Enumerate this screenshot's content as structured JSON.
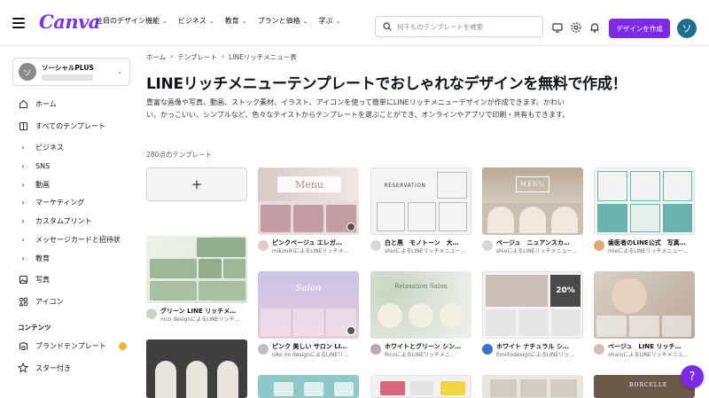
{
  "brand": {
    "logo": "Canva",
    "accent": "#7d2ae8"
  },
  "nav": {
    "items": [
      "注目のデザイン機能",
      "ビジネス",
      "教育",
      "プランと価格",
      "学ぶ"
    ]
  },
  "search": {
    "placeholder": "何千ものテンプレートを検索"
  },
  "header": {
    "cta": "デザインを作成",
    "avatar_initial": "ソ"
  },
  "sidebar": {
    "team": {
      "initial": "ソ",
      "name": "ソーシャルPLUS"
    },
    "items": [
      {
        "label": "ホーム",
        "icon": "home-icon"
      },
      {
        "label": "すべてのテンプレート",
        "icon": "templates-icon"
      },
      {
        "label": "ビジネス",
        "icon": "chevron-right-icon"
      },
      {
        "label": "SNS",
        "icon": "chevron-right-icon"
      },
      {
        "label": "動画",
        "icon": "chevron-right-icon"
      },
      {
        "label": "マーケティング",
        "icon": "chevron-right-icon"
      },
      {
        "label": "カスタムプリント",
        "icon": "chevron-right-icon"
      },
      {
        "label": "メッセージカードと招待状",
        "icon": "chevron-right-icon"
      },
      {
        "label": "教育",
        "icon": "chevron-right-icon"
      },
      {
        "label": "写真",
        "icon": "photo-icon"
      },
      {
        "label": "アイコン",
        "icon": "shapes-icon"
      }
    ],
    "section_heading": "コンテンツ",
    "content_items": [
      {
        "label": "ブランドテンプレート",
        "icon": "brand-icon"
      },
      {
        "label": "スター付き",
        "icon": "star-icon"
      }
    ]
  },
  "breadcrumb": [
    "ホーム",
    "テンプレート",
    "LINEリッチメニュー表"
  ],
  "page": {
    "title": "LINEリッチメニューテンプレートでおしゃれなデザインを無料で作成！",
    "description": "豊富な画像や写真、動画、ストック素材、イラスト、アイコンを使って簡単にLINEリッチメニューデザインが作成できます。かわいい、かっこいい、シンプルなど、色々なテイストからテンプレートを選ぶことができ、オンラインやアプリで印刷・共有もできます。",
    "count": "280点のテンプレート",
    "new_button": "+"
  },
  "templates": [
    {
      "title": "ピンクベージュ エレガ…",
      "by": "mikimikiによるLINEリッチメ…",
      "thumb_text": "Menu"
    },
    {
      "title": "白と黒　モノトーン　大…",
      "by": "shioによるLINEリッチメニュー…",
      "thumb_text": "RESERVATION"
    },
    {
      "title": "ベージュ　ニュアンスカ…",
      "by": "shioによるLINEリッチメニュー…",
      "thumb_text": "MENU"
    },
    {
      "title": "歯医者のLINE公式　写真…",
      "by": "mieによるLINEリッチメニュー…",
      "thumb_text": ""
    },
    {
      "title": "グリーン LINE リッチメ…",
      "by": "nico designによるLINEリッチ…",
      "thumb_text": ""
    },
    {
      "title": "ピンク 美しい サロン LI…",
      "by": "siko no designによるLINEリ…",
      "thumb_text": "Salon"
    },
    {
      "title": "ホワイトとグリーン シン…",
      "by": "RicoによるLINEリッチメニ…",
      "thumb_text": "Relaxation Salon"
    },
    {
      "title": "ホワイト ナチュラル シ…",
      "by": "EmiitodesignによるLINEリッ…",
      "thumb_text": "20%"
    },
    {
      "title": "ベージュ　LINE リッチ…",
      "by": "oharuによるLINEリッチメニュ…",
      "thumb_text": ""
    },
    {
      "title": "",
      "by": "",
      "thumb_text": ""
    },
    {
      "title": "",
      "by": "",
      "thumb_text": ""
    },
    {
      "title": "",
      "by": "",
      "thumb_text": "BORCELLE"
    }
  ],
  "help": "?"
}
